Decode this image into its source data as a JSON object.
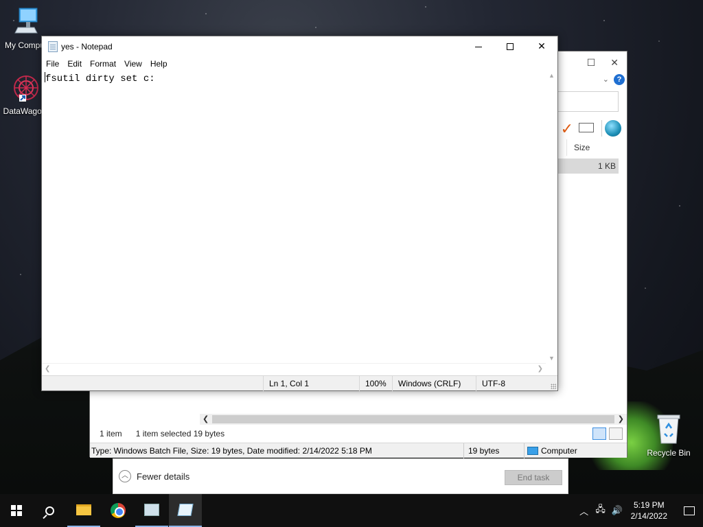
{
  "desktop": {
    "icons": [
      {
        "label": "My Compu",
        "icon": "computer-icon"
      },
      {
        "label": "DataWagon",
        "icon": "datawagon-icon"
      },
      {
        "label": "Recycle Bin",
        "icon": "recycle-bin-icon"
      }
    ]
  },
  "background_window": {
    "column_header": "Size",
    "selected_row_size": "1 KB",
    "status_items": "1 item",
    "status_selected": "1 item selected  19 bytes",
    "details_type": "Type: Windows Batch File, Size: 19 bytes, Date modified: 2/14/2022 5:18 PM",
    "details_size": "19 bytes",
    "details_location": "Computer",
    "help_label": "?"
  },
  "task_manager": {
    "fewer_details": "Fewer details",
    "end_task": "End task"
  },
  "notepad": {
    "title": "yes - Notepad",
    "menu": [
      "File",
      "Edit",
      "Format",
      "View",
      "Help"
    ],
    "content": "fsutil dirty set c:",
    "status": {
      "position": "Ln 1, Col 1",
      "zoom": "100%",
      "line_ending": "Windows (CRLF)",
      "encoding": "UTF-8"
    }
  },
  "taskbar": {
    "apps": [
      "start-icon",
      "search-icon",
      "file-explorer-icon",
      "chrome-icon",
      "task-manager-icon",
      "notepad-icon"
    ],
    "clock_time": "5:19 PM",
    "clock_date": "2/14/2022"
  },
  "colors": {
    "accent": "#1f6fd1",
    "taskbar": "#101010",
    "active_indicator": "#8cb4e8"
  }
}
